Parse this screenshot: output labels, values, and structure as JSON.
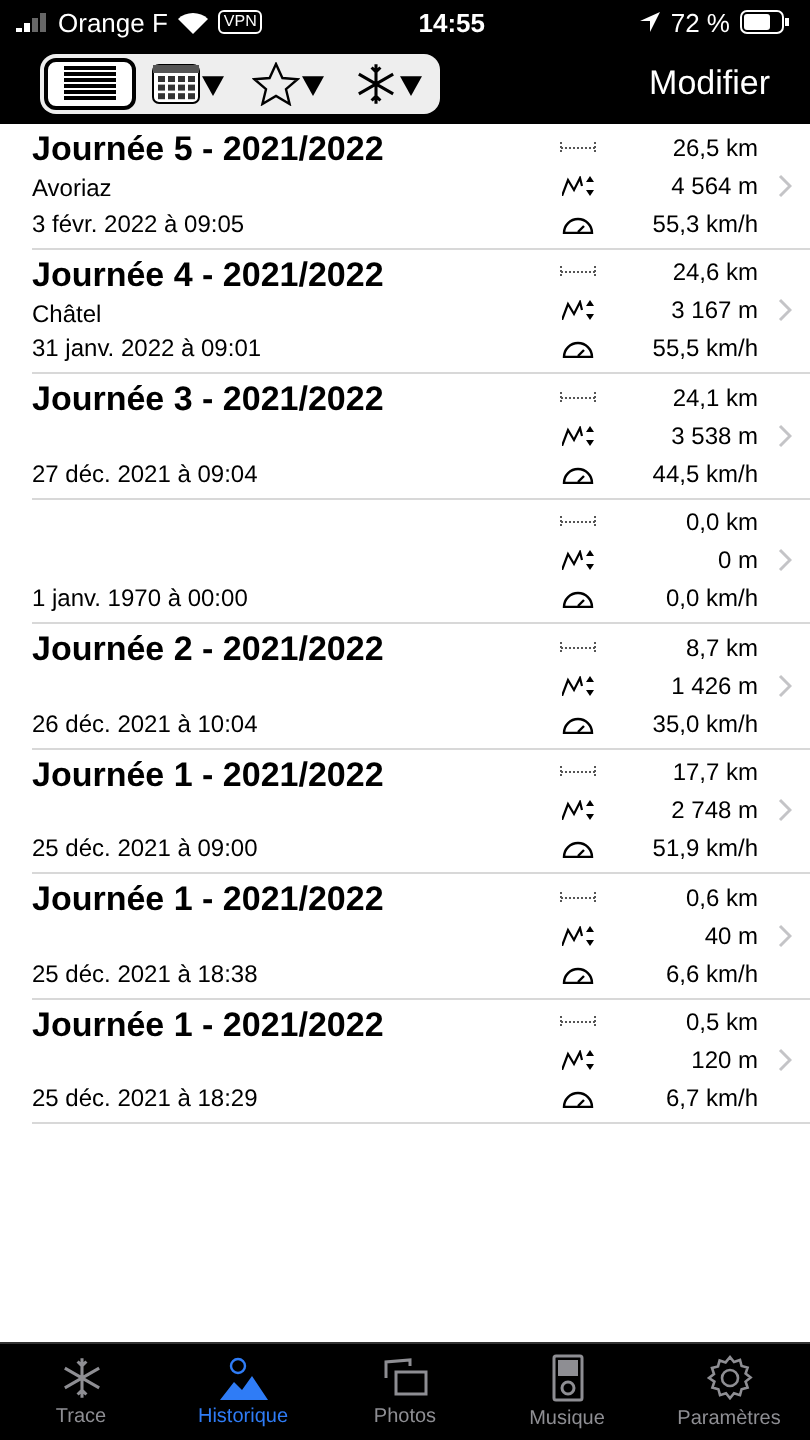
{
  "status_bar": {
    "carrier": "Orange F",
    "vpn": "VPN",
    "time": "14:55",
    "battery": "72 %"
  },
  "nav_bar": {
    "segments": [
      {
        "kind": "list",
        "selected": true
      },
      {
        "kind": "calendar",
        "selected": false
      },
      {
        "kind": "star",
        "selected": false
      },
      {
        "kind": "snowflake",
        "selected": false
      }
    ],
    "edit_button": "Modifier"
  },
  "days": [
    {
      "title": "Journée 5 - 2021/2022",
      "location": "Avoriaz",
      "date": "3 févr. 2022 à 09:05",
      "distance": "26,5 km",
      "elevation": "4 564 m",
      "speed": "55,3 km/h"
    },
    {
      "title": "Journée 4 - 2021/2022",
      "location": "Châtel",
      "date": "31 janv. 2022 à 09:01",
      "distance": "24,6 km",
      "elevation": "3 167 m",
      "speed": "55,5 km/h"
    },
    {
      "title": "Journée 3 - 2021/2022",
      "date": "27 déc. 2021 à 09:04",
      "distance": "24,1 km",
      "elevation": "3 538 m",
      "speed": "44,5 km/h"
    },
    {
      "date": "1 janv. 1970 à 00:00",
      "distance": "0,0 km",
      "elevation": "0 m",
      "speed": "0,0 km/h"
    },
    {
      "title": "Journée 2 - 2021/2022",
      "date": "26 déc. 2021 à 10:04",
      "distance": "8,7 km",
      "elevation": "1 426 m",
      "speed": "35,0 km/h"
    },
    {
      "title": "Journée 1 - 2021/2022",
      "date": "25 déc. 2021 à 09:00",
      "distance": "17,7 km",
      "elevation": "2 748 m",
      "speed": "51,9 km/h"
    },
    {
      "title": "Journée 1 - 2021/2022",
      "date": "25 déc. 2021 à 18:38",
      "distance": "0,6 km",
      "elevation": "40 m",
      "speed": "6,6 km/h"
    },
    {
      "title": "Journée 1 - 2021/2022",
      "date": "25 déc. 2021 à 18:29",
      "distance": "0,5 km",
      "elevation": "120 m",
      "speed": "6,7 km/h"
    }
  ],
  "tab_bar": [
    {
      "kind": "snowflake",
      "label": "Trace",
      "selected": false
    },
    {
      "kind": "history",
      "label": "Historique",
      "selected": true
    },
    {
      "kind": "photos",
      "label": "Photos",
      "selected": false
    },
    {
      "kind": "music",
      "label": "Musique",
      "selected": false
    },
    {
      "kind": "settings",
      "label": "Paramètres",
      "selected": false
    }
  ]
}
